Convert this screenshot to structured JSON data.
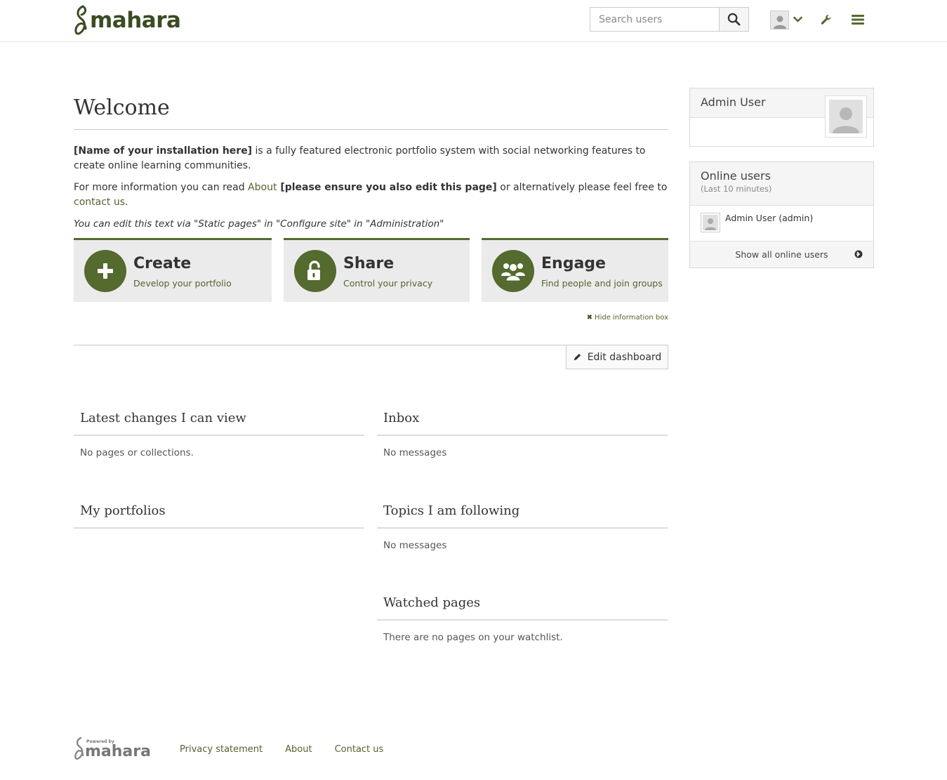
{
  "header": {
    "logo_text": "mahara",
    "search": {
      "placeholder": "Search users"
    }
  },
  "main": {
    "title": "Welcome",
    "intro": {
      "p1_bold": "[Name of your installation here]",
      "p1_rest": " is a fully featured electronic portfolio system with social networking features to create online learning communities.",
      "p2_start": "For more information you can read ",
      "p2_link_about": "About",
      "p2_bold": " [please ensure you also edit this page]",
      "p2_mid": " or alternatively please feel free to ",
      "p2_link_contact": "contact us",
      "p2_end": ".",
      "p3_italic": "You can edit this text via \"Static pages\" in \"Configure site\" in \"Administration\""
    },
    "cards": [
      {
        "title": "Create",
        "subtitle": "Develop your portfolio",
        "icon": "plus-icon"
      },
      {
        "title": "Share",
        "subtitle": "Control your privacy",
        "icon": "unlock-icon"
      },
      {
        "title": "Engage",
        "subtitle": "Find people and join groups",
        "icon": "users-icon"
      }
    ],
    "hide_info_box": "Hide information box",
    "edit_dashboard": "Edit dashboard",
    "blocks": {
      "latest_changes": {
        "title": "Latest changes I can view",
        "body": "No pages or collections."
      },
      "inbox": {
        "title": "Inbox",
        "body": "No messages"
      },
      "my_portfolios": {
        "title": "My portfolios",
        "body": ""
      },
      "topics": {
        "title": "Topics I am following",
        "body": "No messages"
      },
      "watched": {
        "title": "Watched pages",
        "body": "There are no pages on your watchlist."
      }
    }
  },
  "sidebar": {
    "profile": {
      "name": "Admin User"
    },
    "online_users": {
      "title": "Online users",
      "subtitle": "(Last 10 minutes)",
      "users": [
        "Admin User (admin)"
      ],
      "show_all": "Show all online users"
    }
  },
  "footer": {
    "powered_by": "Powered by",
    "logo_text": "mahara",
    "links": [
      "Privacy statement",
      "About",
      "Contact us"
    ]
  },
  "colors": {
    "brand_dark": "#3b4c22",
    "brand": "#546a2e",
    "link": "#53632f"
  }
}
